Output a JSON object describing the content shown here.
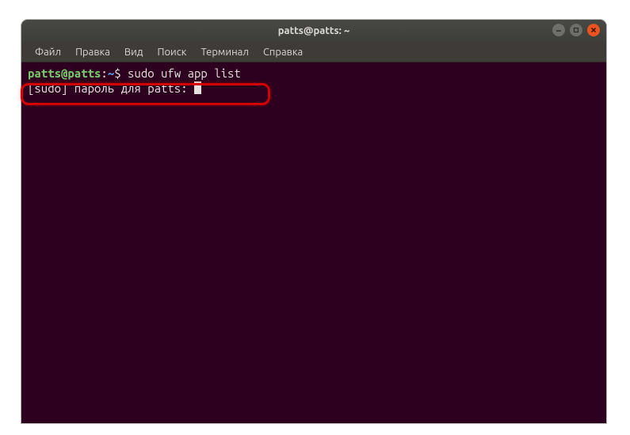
{
  "window": {
    "title": "patts@patts: ~"
  },
  "menu": {
    "file": "Файл",
    "edit": "Правка",
    "view": "Вид",
    "search": "Поиск",
    "terminal": "Терминал",
    "help": "Справка"
  },
  "terminal": {
    "user_host": "patts@patts",
    "separator": ":",
    "path": "~",
    "prompt_symbol": "$",
    "command": "sudo ufw app list",
    "sudo_prompt": "[sudo] пароль для patts: "
  },
  "colors": {
    "terminal_bg": "#2c001e",
    "prompt_user": "#7bc96f",
    "prompt_path": "#5e8ed6",
    "close_btn": "#e95420",
    "annotation": "#d40000"
  }
}
